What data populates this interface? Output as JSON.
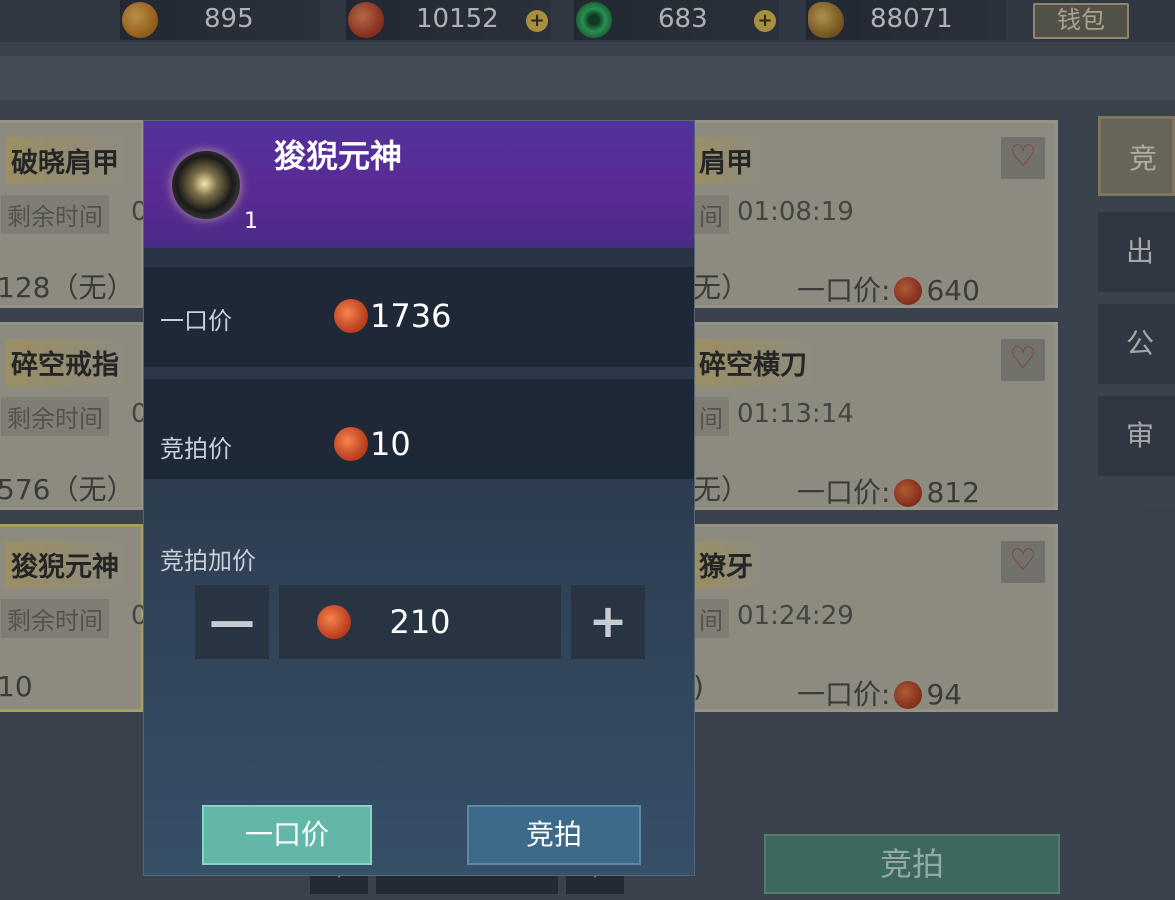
{
  "currencies": [
    {
      "name": "gold-ingot",
      "value": "895",
      "color": "#e39a2b"
    },
    {
      "name": "red-coin",
      "value": "10152",
      "color": "#d24a23"
    },
    {
      "name": "jade",
      "value": "683",
      "color": "#2faa55"
    },
    {
      "name": "bronze-shell",
      "value": "88071",
      "color": "#c79a3a"
    }
  ],
  "wallet_label": "钱包",
  "cards": [
    {
      "name": "破晓肩甲",
      "tag": "剩余时间",
      "time": "0",
      "price": "128（无）"
    },
    {
      "name": "碎空戒指",
      "tag": "剩余时间",
      "time": "0",
      "price": "576（无）"
    },
    {
      "name": "狻猊元神",
      "tag": "剩余时间",
      "time": "0",
      "price": "10"
    },
    {
      "name": "肩甲",
      "tag": "间",
      "time": "01:08:19",
      "price": "无）",
      "buy_label": "一口价:",
      "buy": "640"
    },
    {
      "name": "碎空横刀",
      "tag": "间",
      "time": "01:13:14",
      "price": "无）",
      "buy_label": "一口价:",
      "buy": "812"
    },
    {
      "name": "獠牙",
      "tag": "间",
      "time": "01:24:29",
      "price": ")",
      "buy_label": "一口价:",
      "buy": "94"
    }
  ],
  "side_tabs": [
    "竞拍",
    "出售",
    "公示",
    "审核"
  ],
  "bottom_bid_label": "竞拍",
  "popup": {
    "title": "狻猊元神",
    "count": "1",
    "buyout_label": "一口价",
    "buyout_value": "1736",
    "bid_label": "竞拍价",
    "bid_value": "10",
    "increment_label": "竞拍加价",
    "increment_value": "210",
    "minus": "—",
    "plus": "+",
    "buy_button": "一口价",
    "bid_button": "竞拍"
  }
}
